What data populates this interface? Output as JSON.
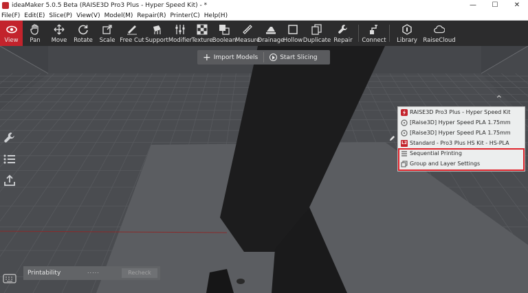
{
  "window": {
    "title": "ideaMaker 5.0.5 Beta (RAISE3D Pro3 Plus - Hyper Speed Kit) - *",
    "controls": [
      "—",
      "☐",
      "✕"
    ]
  },
  "menu": [
    "File(F)",
    "Edit(E)",
    "Slice(P)",
    "View(V)",
    "Model(M)",
    "Repair(R)",
    "Printer(C)",
    "Help(H)"
  ],
  "toolbar": {
    "tools": [
      "View",
      "Pan",
      "Move",
      "Rotate",
      "Scale",
      "Free Cut",
      "Support",
      "Modifier",
      "Texture",
      "Boolean",
      "Measure",
      "Drainage",
      "Hollow",
      "Duplicate",
      "Repair",
      "Connect",
      "Library",
      "RaiseCloud"
    ],
    "active": "View",
    "active_color": "#c3232c"
  },
  "actions": {
    "import_label": "Import Models",
    "slice_label": "Start Slicing"
  },
  "panel": {
    "rows": [
      {
        "icon": "raise3d-bolt-icon",
        "label": "RAISE3D Pro3 Plus - Hyper Speed Kit"
      },
      {
        "icon": "filament-left-icon",
        "label": "[Raise3D] Hyper Speed PLA 1.75mm"
      },
      {
        "icon": "filament-right-icon",
        "label": "[Raise3D] Hyper Speed PLA 1.75mm"
      },
      {
        "icon": "profile-l2-icon",
        "label": "Standard - Pro3 Plus HS Kit - HS-PLA"
      },
      {
        "icon": "sequential-icon",
        "label": "Sequential Printing"
      },
      {
        "icon": "group-layer-icon",
        "label": "Group and Layer Settings"
      }
    ],
    "l2_badge": "L2",
    "highlight_color": "#e0242c"
  },
  "printability": {
    "label": "Printability",
    "recheck_label": "Recheck",
    "handle": "....."
  }
}
